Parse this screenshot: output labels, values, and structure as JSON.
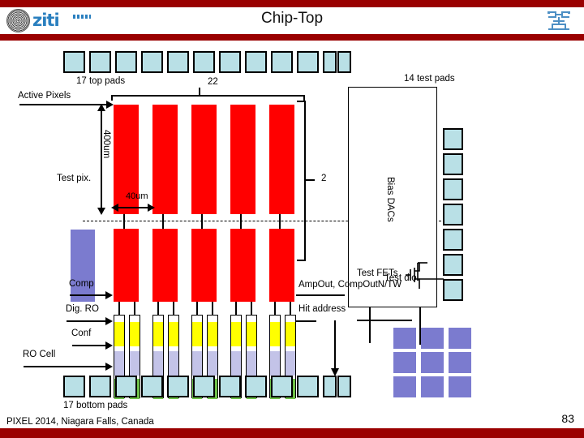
{
  "header": {
    "title": "Chip-Top",
    "logo_left_name": "ziti",
    "logo_left_icon": "university-seal-icon",
    "logo_right_icon": "transistor-logo-icon",
    "accent_color": "#9a0000"
  },
  "footer": {
    "conference": "PIXEL 2014, Niagara Falls, Canada",
    "page_number": "83"
  },
  "diagram": {
    "labels": {
      "top_pads": "17 top pads",
      "bottom_pads": "17 bottom pads",
      "test_pads": "14 test pads",
      "col_count": "22",
      "row_count": "2",
      "active_pixels": "Active Pixels",
      "pixel_height": "400um",
      "pixel_width": "40um",
      "test_pix": "Test pix.",
      "bias_dacs": "Bias DACs",
      "test_fets": "Test FETs",
      "test_dio": "Test dio.",
      "comp": "Comp",
      "dig_ro": "Dig. RO",
      "conf": "Conf",
      "ro_cell": "RO Cell",
      "amp_out": "AmpOut, CompOutN/TW",
      "hit_address": "Hit address"
    },
    "colors": {
      "pad": "#b9e0e6",
      "pixel": "#ff0000",
      "test_pixel": "#7b7bcf",
      "comp_segment": "#ffff00",
      "dig_ro_segment": "#c3c3e8",
      "conf_segment": "#6fc24a",
      "diode": "#7b7bcf",
      "outline": "#000000"
    },
    "counts": {
      "top_pads_drawn": 12,
      "bottom_pads_drawn": 12,
      "test_pads_drawn": 7,
      "pixel_columns": 5,
      "ro_cell_pairs": 5,
      "test_diodes": 9
    }
  }
}
